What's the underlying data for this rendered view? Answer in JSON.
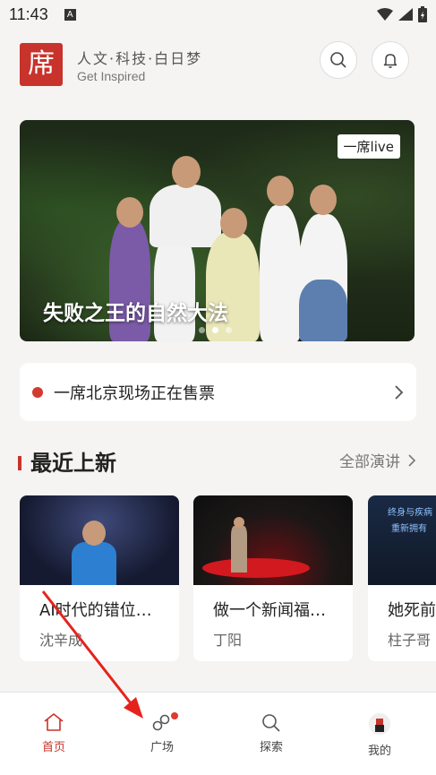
{
  "status": {
    "time": "11:43",
    "notif_letter": "A"
  },
  "header": {
    "logo_char": "席",
    "slogan": "人文·科技·白日梦",
    "sub_slogan": "Get Inspired"
  },
  "banner": {
    "tag": "一席live",
    "title": "失败之王的自然大法",
    "slides": 3,
    "active_slide": 2
  },
  "ticket": {
    "text": "一席北京现场正在售票"
  },
  "section": {
    "title": "最近上新",
    "more": "全部演讲"
  },
  "cards": [
    {
      "title": "AI时代的错位…",
      "author": "沈辛成"
    },
    {
      "title": "做一个新闻福…",
      "author": "丁阳"
    },
    {
      "title": "她死前",
      "author": "柱子哥",
      "thumb_text_1": "终身与疾病",
      "thumb_text_2": "重新拥有"
    }
  ],
  "tabs": [
    {
      "label": "首页",
      "icon": "home-icon",
      "active": true
    },
    {
      "label": "广场",
      "icon": "square-icon",
      "active": false
    },
    {
      "label": "探索",
      "icon": "search-icon",
      "active": false
    },
    {
      "label": "我的",
      "icon": "avatar-icon",
      "active": false
    }
  ],
  "colors": {
    "brand": "#c8332b",
    "background": "#f5f4f2"
  }
}
